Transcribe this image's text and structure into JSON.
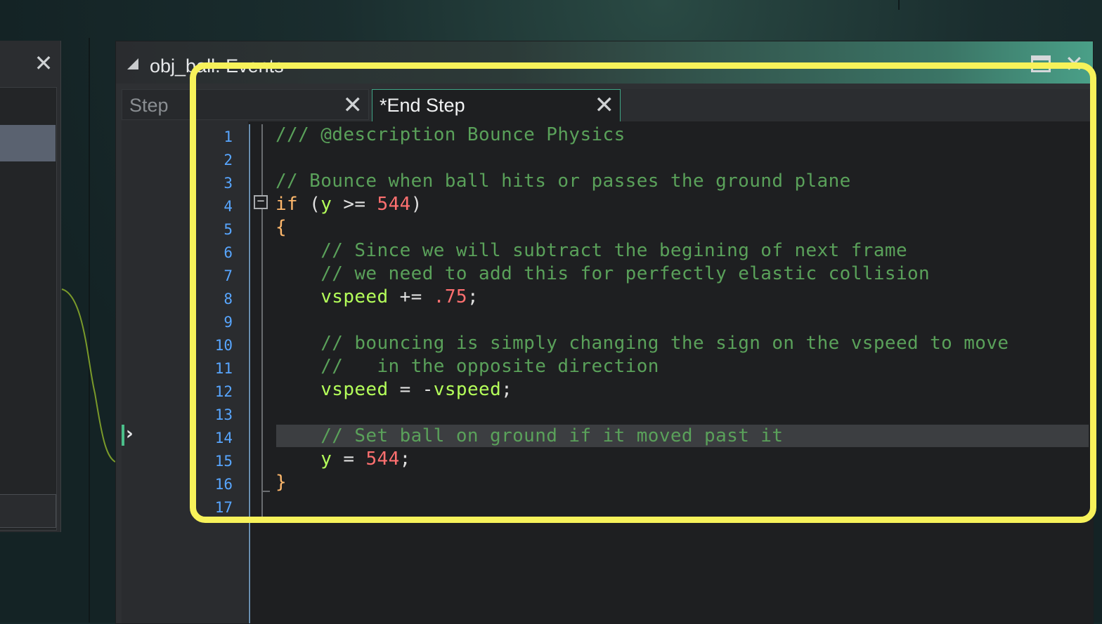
{
  "window": {
    "title": "obj_ball: Events",
    "close_symbol": "✕"
  },
  "left_panel": {
    "close_symbol": "✕"
  },
  "tabs": [
    {
      "label": "Step",
      "close_symbol": "✕",
      "active": false
    },
    {
      "label": "*End Step",
      "close_symbol": "✕",
      "active": true
    }
  ],
  "editor": {
    "line_numbers": [
      "1",
      "2",
      "3",
      "4",
      "5",
      "6",
      "7",
      "8",
      "9",
      "10",
      "11",
      "12",
      "13",
      "14",
      "15",
      "16",
      "17"
    ],
    "lines": [
      "/// @description Bounce Physics",
      "",
      "// Bounce when ball hits or passes the ground plane",
      "if (y >= 544)",
      "{",
      "    // Since we will subtract the begining of next frame",
      "    // we need to add this for perfectly elastic collision",
      "    vspeed += .75;",
      "",
      "    // bouncing is simply changing the sign on the vspeed to move",
      "    //   in the opposite direction",
      "    vspeed = -vspeed;",
      "",
      "    // Set ball on ground if it moved past it",
      "    y = 544;",
      "}",
      ""
    ],
    "highlighted_line": 14,
    "fold_symbol": "−"
  },
  "colors": {
    "comment": "#5aa15a",
    "keyword": "#ffb86c",
    "variable": "#b4ff5a",
    "number": "#ff7070",
    "line_number": "#58a6ff",
    "highlight_box": "#f7f25a",
    "active_tab_border": "#3fa585"
  }
}
